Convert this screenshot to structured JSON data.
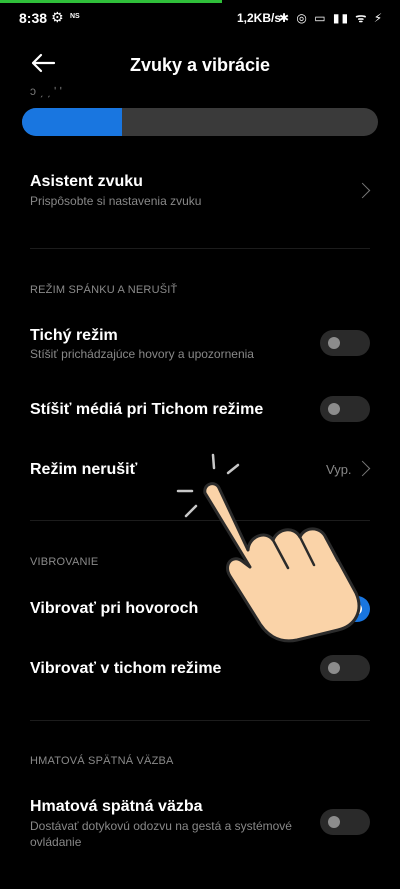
{
  "status_bar": {
    "time": "8:38",
    "ns": "NS",
    "speed": "1,2KB/s",
    "icons": "✱ ◎ ▭ ▮▮ ᯤ ⚡"
  },
  "header": {
    "title": "Zvuky a vibrácie",
    "back_icon": "back-arrow-icon"
  },
  "volume_slider": {
    "level_percent": 28,
    "label_cut": "ɔ ˏ ˏ ʹ ʹ"
  },
  "items": {
    "sound_assistant": {
      "title": "Asistent zvuku",
      "subtitle": "Prispôsobte si nastavenia zvuku"
    },
    "silent_mode": {
      "title": "Tichý režim",
      "subtitle": "Stíšiť prichádzajúce hovory a upozornenia",
      "enabled": false
    },
    "mute_media": {
      "title": "Stíšiť médiá pri Tichom režime",
      "enabled": false
    },
    "dnd": {
      "title": "Režim nerušiť",
      "value": "Vyp."
    },
    "vibrate_calls": {
      "title": "Vibrovať pri hovoroch",
      "enabled": true
    },
    "vibrate_silent": {
      "title": "Vibrovať v tichom režime",
      "enabled": false
    },
    "haptic": {
      "title": "Hmatová spätná väzba",
      "subtitle_line1": "Dostávať dotykovú odozvu na gestá a systémové",
      "subtitle_line2": "ovládanie",
      "enabled": false
    }
  },
  "sections": {
    "sleep_dnd": "REŽIM SPÁNKU A NERUŠIŤ",
    "vibration": "VIBROVANIE",
    "haptic": "HMATOVÁ SPÄTNÁ VÄZBA"
  },
  "colors": {
    "accent": "#1976e0",
    "background": "#000000",
    "progress_top": "#2fbf3a"
  }
}
